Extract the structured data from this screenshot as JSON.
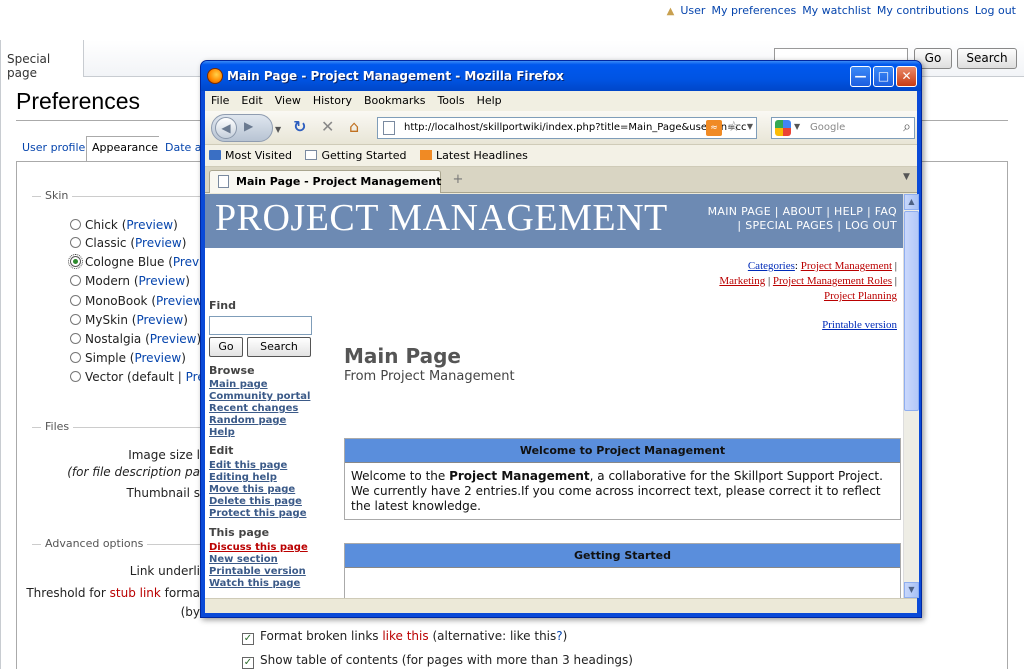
{
  "personal": {
    "links": [
      "User",
      "My preferences",
      "My watchlist",
      "My contributions",
      "Log out"
    ]
  },
  "tabs": {
    "special_page": "Special page"
  },
  "search": {
    "go_label": "Go",
    "search_label": "Search"
  },
  "preferences": {
    "title": "Preferences",
    "tabs": [
      "User profile",
      "Appearance",
      "Date a"
    ],
    "skin_legend": "Skin",
    "skins": [
      {
        "name": "Chick",
        "link": "Preview",
        "checked": false
      },
      {
        "name": "Classic",
        "link": "Preview",
        "checked": false
      },
      {
        "name": "Cologne Blue",
        "link": "Previe",
        "checked": true
      },
      {
        "name": "Modern",
        "link": "Preview",
        "checked": false
      },
      {
        "name": "MonoBook",
        "link": "Preview",
        "checked": false
      },
      {
        "name": "MySkin",
        "link": "Preview",
        "checked": false
      },
      {
        "name": "Nostalgia",
        "link": "Preview",
        "checked": false
      },
      {
        "name": "Simple",
        "link": "Preview",
        "checked": false
      },
      {
        "name": "Vector (default | ",
        "link": "Prev",
        "checked": false
      }
    ],
    "files_legend": "Files",
    "image_size_label": "Image size l",
    "image_size_note": "(for file description pa",
    "thumbnail_label": "Thumbnail s",
    "advanced_legend": "Advanced options",
    "link_underline_label": "Link underli",
    "threshold_prefix": "Threshold for ",
    "threshold_link": "stub link",
    "threshold_suffix": " forma",
    "threshold_note": "(by",
    "broken_links_prefix": "Format broken links ",
    "broken_links_link": "like this",
    "broken_links_mid": " (alternative: like this",
    "broken_links_q": "?",
    "broken_links_end": ")",
    "toc_label": "Show table of contents (for pages with more than 3 headings)"
  },
  "firefox": {
    "title": "Main Page - Project Management - Mozilla Firefox",
    "menu": [
      "File",
      "Edit",
      "View",
      "History",
      "Bookmarks",
      "Tools",
      "Help"
    ],
    "url": "http://localhost/skillportwiki/index.php?title=Main_Page&useskin=cc",
    "search_placeholder": "Google",
    "bookmarks": [
      "Most Visited",
      "Getting Started",
      "Latest Headlines"
    ],
    "tab_title": "Main Page - Project Management",
    "new_tab": "+"
  },
  "wiki": {
    "logo": "PROJECT MANAGEMENT",
    "topnav_line1": "MAIN PAGE | ABOUT | HELP | FAQ",
    "topnav_line2": "| SPECIAL PAGES | LOG OUT",
    "categories_label": "Categories",
    "categories": [
      "Project Management",
      "Marketing",
      "Project Management Roles",
      "Project Planning"
    ],
    "printable": "Printable version",
    "find_head": "Find",
    "go_label": "Go",
    "search_label": "Search",
    "browse_head": "Browse",
    "browse_links": [
      "Main page",
      "Community portal",
      "Recent changes",
      "Random page",
      "Help"
    ],
    "edit_head": "Edit",
    "edit_links": [
      "Edit this page",
      "Editing help",
      "Move this page",
      "Delete this page",
      "Protect this page"
    ],
    "thispage_head": "This page",
    "thispage_links": [
      "Discuss this page",
      "New section",
      "Printable version",
      "Watch this page"
    ],
    "main_title": "Main Page",
    "from": "From Project Management",
    "welcome_head": "Welcome to Project Management",
    "welcome_pre": "Welcome to the ",
    "welcome_bold": "Project Management",
    "welcome_post": ", a collaborative for the Skillport Support Project. We currently have 2 entries.If you come across incorrect text, please correct it to reflect the latest knowledge.",
    "getting_started_head": "Getting Started"
  }
}
